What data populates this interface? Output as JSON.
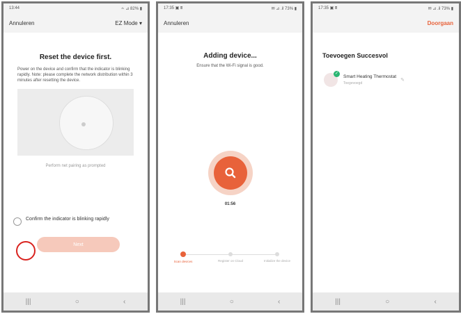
{
  "screen1": {
    "status": {
      "time": "13:44",
      "icons": "⩪ ⊿ 82% ▮"
    },
    "topbar": {
      "left": "Annuleren",
      "right": "EZ Mode ▾"
    },
    "title": "Reset the device first.",
    "description": "Power on the device and confirm that the indicator is blinking rapidly. Note: please complete the network distribution within 3 minutes after resetting the device.",
    "link": "Perform net pairing as prompted",
    "confirm_text": "Confirm the indicator is blinking rapidly",
    "next_label": "Next",
    "nav": [
      "|||",
      "○",
      "‹"
    ]
  },
  "screen2": {
    "status": {
      "time": "17:35 ▣ ⩩",
      "icons": "✉ ⊿ .il 73% ▮"
    },
    "topbar": {
      "left": "Annuleren"
    },
    "title": "Adding device...",
    "subtitle": "Ensure that the Wi-Fi signal is good.",
    "timer": "01:56",
    "steps": [
      "Scan devices",
      "Register on Cloud",
      "Initialize the device"
    ],
    "nav": [
      "|||",
      "○",
      "‹"
    ]
  },
  "screen3": {
    "status": {
      "time": "17:35 ▣ ⩩",
      "icons": "✉ ⊿ .il 73% ▮"
    },
    "topbar": {
      "right": "Doorgaan"
    },
    "title": "Toevoegen Succesvol",
    "device_name": "Smart Heating Thermostat",
    "device_status": "Toegevoegd",
    "nav": [
      "|||",
      "○",
      "‹"
    ]
  }
}
